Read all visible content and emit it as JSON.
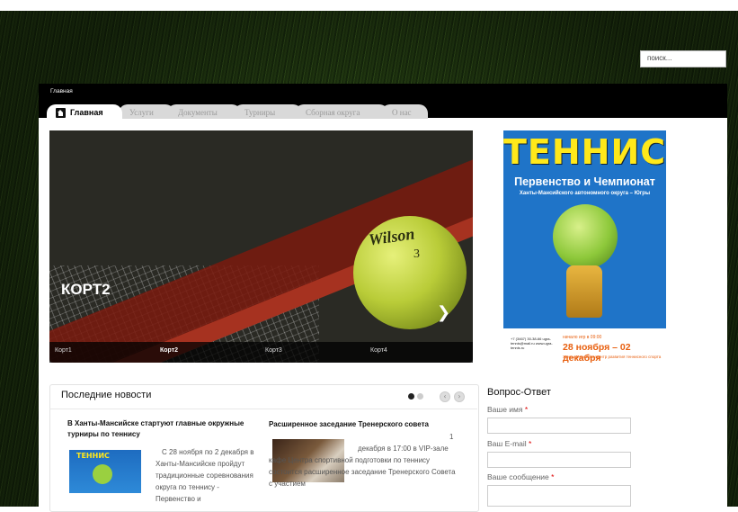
{
  "search": {
    "placeholder": "поиск..."
  },
  "breadcrumb": "Главная",
  "nav": {
    "tabs": [
      {
        "label": "Главная",
        "active": true,
        "icon": "home-icon"
      },
      {
        "label": "Услуги"
      },
      {
        "label": "Документы"
      },
      {
        "label": "Турниры"
      },
      {
        "label": "Сборная округа"
      },
      {
        "label": "О нас"
      }
    ]
  },
  "slider": {
    "title": "КОРТ2",
    "ball_brand": "Wilson",
    "ball_number": "3",
    "thumbs": [
      "Корт1",
      "Корт2",
      "Корт3",
      "Корт4"
    ],
    "active_index": 1,
    "next_icon": "chevron-right-icon"
  },
  "poster": {
    "title": "ТЕННИС",
    "subtitle": "Первенство и Чемпионат",
    "region": "Ханты-Мансийского автономного округа – Югры",
    "start_note": "начало игр в 09:00",
    "dates": "28 ноября – 02 декабря",
    "contacts": "+7 (3467) 30-38-66 ugra-tennis@mail.ru www.ugra-tennis.ru",
    "org": "Ханты-Мансийск Центр развития теннисного спорта"
  },
  "news": {
    "title": "Последние новости",
    "articles": [
      {
        "title": "В Ханты-Мансийске стартуют главные окружные турниры по теннису",
        "image_text": "ТЕННИС",
        "text": "С 28 ноября по 2 декабря в Ханты-Мансийске пройдут традиционные соревнования округа по теннису - Первенство и"
      },
      {
        "title": "Расширенное заседание Тренерского совета",
        "text_num": "1",
        "text": "декабря в 17:00 в VIP-зале кафе Центра спортивной подготовки по теннису состоится расширенное заседание Тренерского Совета с участием"
      }
    ],
    "prev_icon": "chevron-left-icon",
    "next_icon": "chevron-right-icon"
  },
  "qa": {
    "title": "Вопрос-Ответ",
    "fields": [
      {
        "label": "Ваше имя",
        "required_mark": "*"
      },
      {
        "label": "Ваш E-mail",
        "required_mark": "*"
      },
      {
        "label": "Ваше сообщение",
        "required_mark": "*"
      }
    ]
  }
}
